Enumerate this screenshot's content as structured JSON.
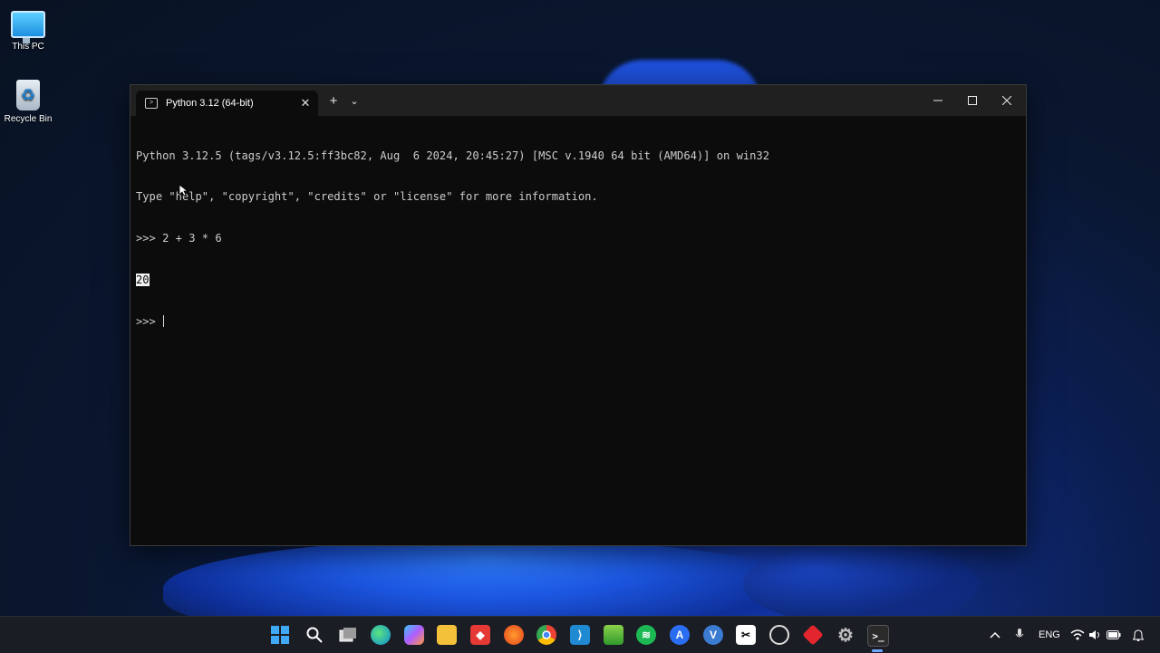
{
  "desktop": {
    "icons": [
      {
        "label": "This PC"
      },
      {
        "label": "Recycle Bin"
      }
    ]
  },
  "window": {
    "tab_title": "Python 3.12 (64-bit)",
    "tab_close": "✕",
    "new_tab": "+",
    "dropdown": "⌄",
    "minimize": "—",
    "maximize": "☐",
    "close": "✕"
  },
  "console": {
    "lines": [
      "Python 3.12.5 (tags/v3.12.5:ff3bc82, Aug  6 2024, 20:45:27) [MSC v.1940 64 bit (AMD64)] on win32",
      "Type \"help\", \"copyright\", \"credits\" or \"license\" for more information.",
      ">>> 2 + 3 * 6"
    ],
    "result": "20",
    "prompt": ">>> "
  },
  "taskbar": {
    "tray_language": "ENG",
    "apps": [
      "start",
      "search",
      "task-view",
      "edge",
      "copilot",
      "file-explorer",
      "anydesk",
      "firefox",
      "chrome",
      "vscode",
      "bluestacks",
      "spotify",
      "app-store",
      "vyond",
      "capcut",
      "github",
      "gift-app",
      "settings",
      "terminal"
    ]
  },
  "colors": {
    "terminal_bg": "#0c0c0c",
    "terminal_text": "#cccccc",
    "titlebar_bg": "#202020",
    "taskbar_bg": "#1b1d24"
  }
}
